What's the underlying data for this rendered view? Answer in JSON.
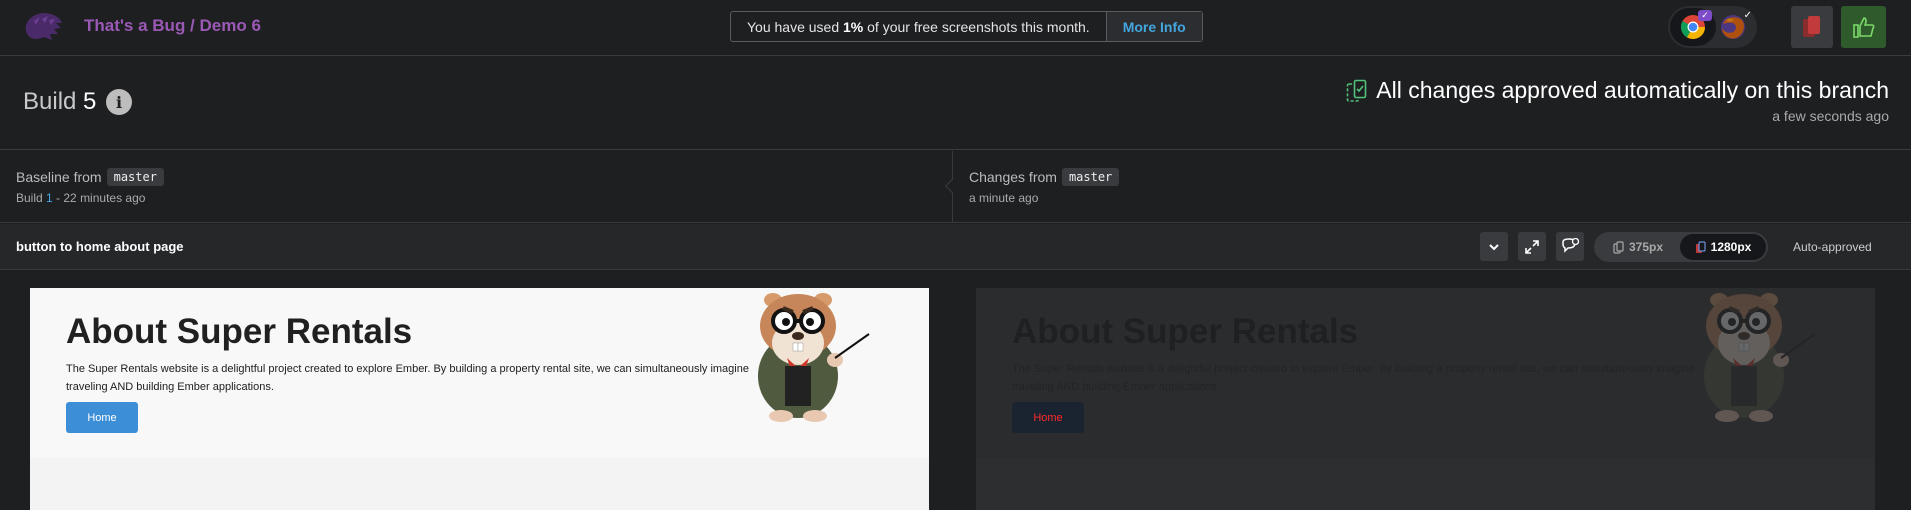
{
  "topbar": {
    "title": "That's a Bug / Demo 6",
    "usage_prefix": "You have used ",
    "usage_percent": "1%",
    "usage_suffix": " of your free screenshots this month.",
    "more_info_label": "More Info",
    "browsers": [
      {
        "name": "chrome",
        "icon": "chrome-icon",
        "approved": true,
        "active": true
      },
      {
        "name": "firefox",
        "icon": "firefox-icon",
        "approved": true,
        "active": false
      }
    ],
    "brand_color": "#9b59b6",
    "link_color": "#43a6dd"
  },
  "build": {
    "label": "Build",
    "number": "5",
    "info_glyph": "i",
    "status_text": "All changes approved automatically on this branch",
    "status_time": "a few seconds ago"
  },
  "compare": {
    "baseline_label": "Baseline from",
    "baseline_branch": "master",
    "baseline_build_prefix": "Build ",
    "baseline_build_number": "1",
    "baseline_build_suffix": " - 22 minutes ago",
    "changes_label": "Changes from",
    "changes_branch": "master",
    "changes_time": "a minute ago"
  },
  "snapshot": {
    "name": "button to home about page",
    "widths": [
      {
        "label": "375px",
        "active": false
      },
      {
        "label": "1280px",
        "active": true
      }
    ],
    "status": "Auto-approved"
  },
  "page_content": {
    "heading": "About Super Rentals",
    "body": "The Super Rentals website is a delightful project created to explore Ember. By building a property rental site, we can simultaneously imagine traveling AND building Ember applications.",
    "button_label": "Home"
  }
}
